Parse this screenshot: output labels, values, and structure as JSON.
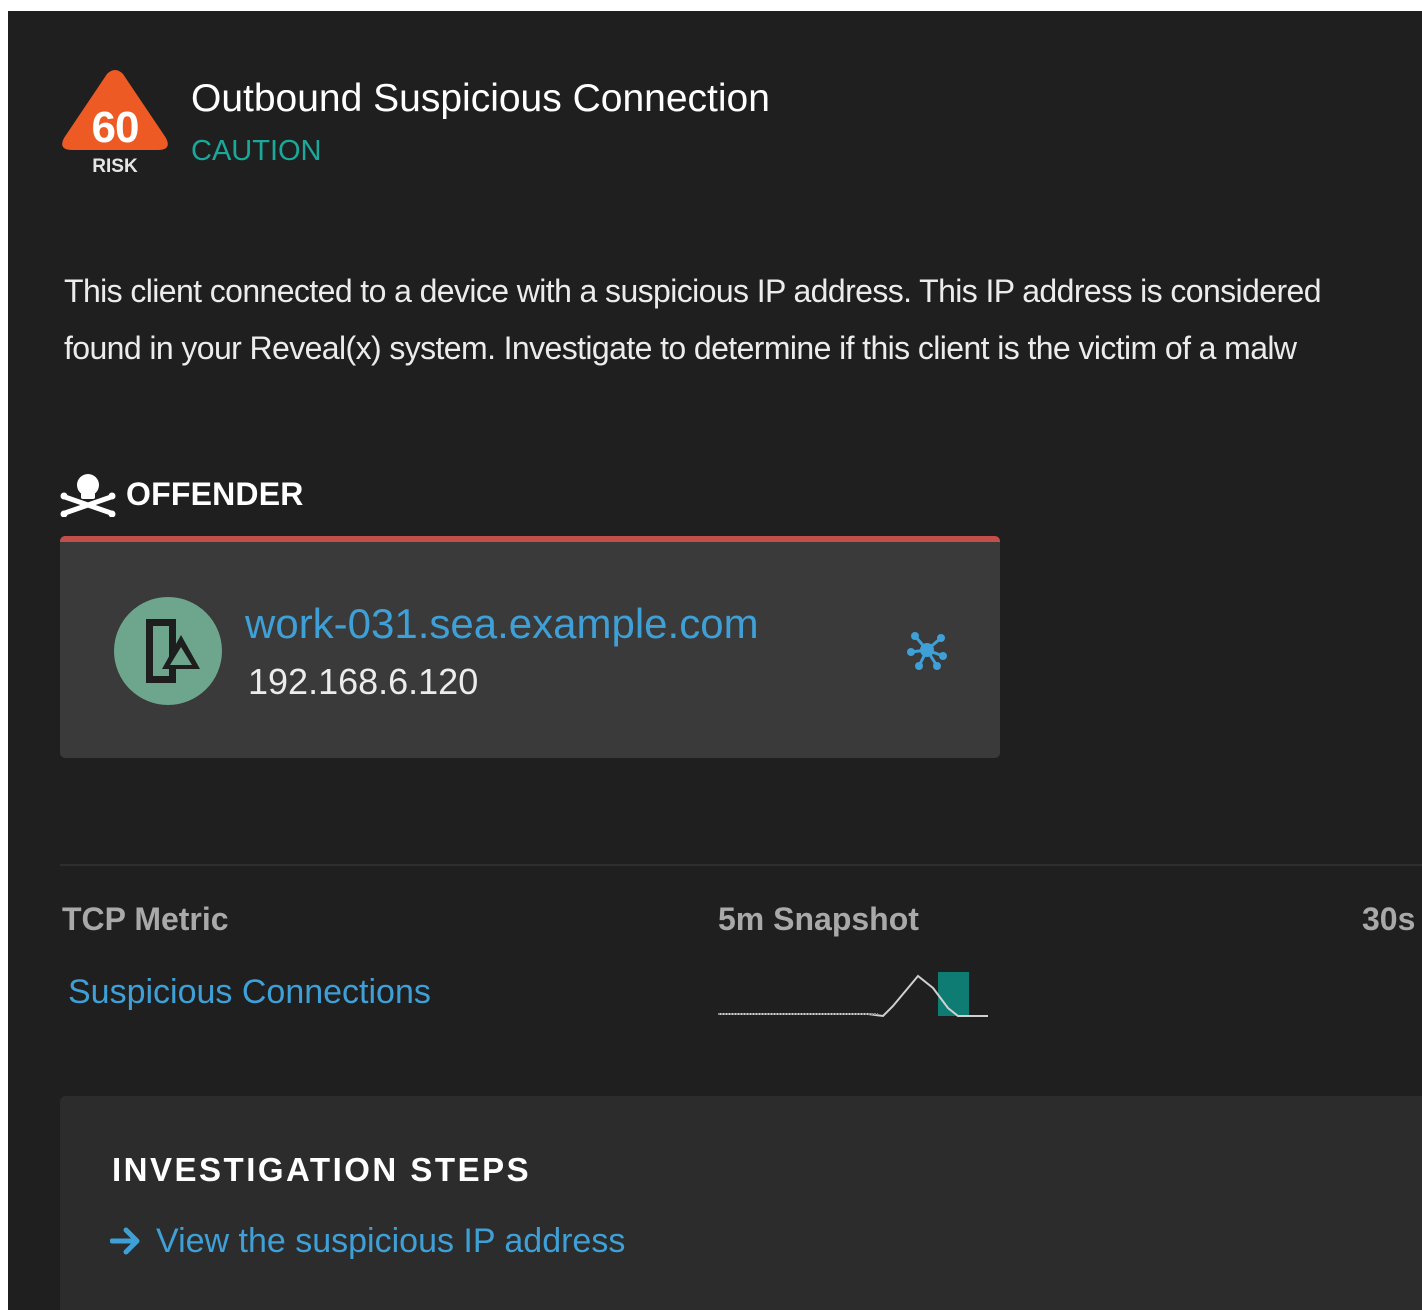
{
  "detection": {
    "risk_score": "60",
    "risk_label": "RISK",
    "title": "Outbound Suspicious Connection",
    "severity": "CAUTION",
    "severity_color": "#1aa89a",
    "risk_color": "#ee5a24",
    "description_line1": "This client connected to a device with a suspicious IP address. This IP address is considered",
    "description_line2": "found in your Reveal(x) system. Investigate to determine if this client is the victim of a malw"
  },
  "offender": {
    "header_label": "OFFENDER",
    "header_icon": "skull-crossbones-icon",
    "accent_color": "#c24f4a",
    "device_name": "work-031.sea.example.com",
    "device_ip": "192.168.6.120",
    "device_icon": "device-role-icon",
    "action_icon": "activity-map-icon"
  },
  "metrics": {
    "columns": [
      "TCP Metric",
      "5m Snapshot",
      "30s"
    ],
    "rows": [
      {
        "metric": "Suspicious Connections"
      }
    ]
  },
  "investigation": {
    "title": "INVESTIGATION STEPS",
    "steps": [
      {
        "label": "View the suspicious IP address",
        "icon": "arrow-right-icon"
      }
    ]
  }
}
